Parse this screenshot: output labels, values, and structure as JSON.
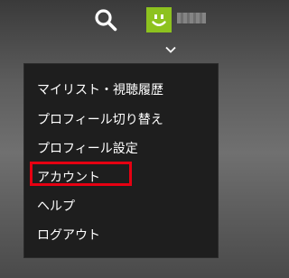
{
  "header": {
    "icons": {
      "search": "search-icon",
      "avatar": "smiley-avatar-icon",
      "expand": "chevron-down-icon"
    },
    "avatar_color": "#8dc21f"
  },
  "menu": {
    "items": [
      {
        "label": "マイリスト・視聴履歴"
      },
      {
        "label": "プロフィール切り替え"
      },
      {
        "label": "プロフィール設定"
      },
      {
        "label": "アカウント",
        "highlighted": true
      },
      {
        "label": "ヘルプ"
      },
      {
        "label": "ログアウト"
      }
    ],
    "highlight_color": "#e60012"
  }
}
